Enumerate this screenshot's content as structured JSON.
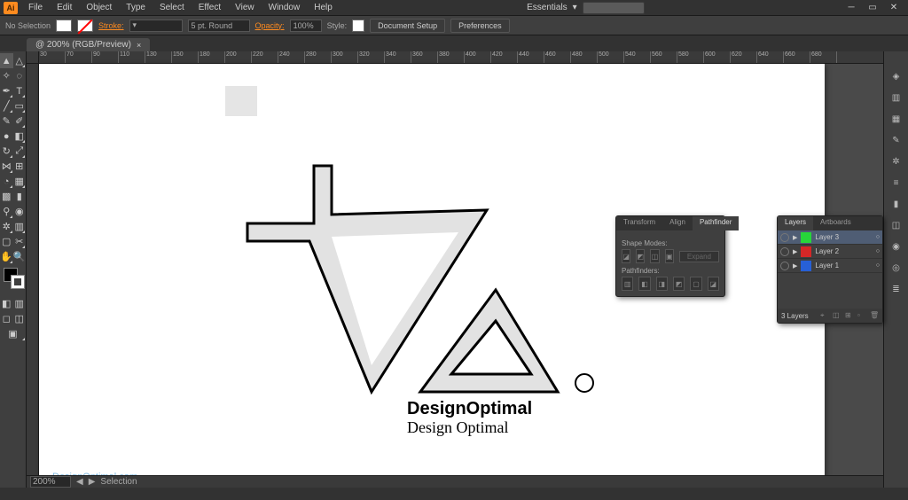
{
  "menu": {
    "items": [
      "File",
      "Edit",
      "Object",
      "Type",
      "Select",
      "Effect",
      "View",
      "Window",
      "Help"
    ],
    "app_badge": "Ai",
    "workspace": "Essentials"
  },
  "optionbar": {
    "no_selection": "No Selection",
    "stroke_label": "Stroke:",
    "stroke_val": "5 pt. Round",
    "opacity_label": "Opacity:",
    "opacity_val": "100%",
    "style_label": "Style:",
    "doc_setup": "Document Setup",
    "prefs": "Preferences"
  },
  "document": {
    "tab_title": "@ 200% (RGB/Preview)"
  },
  "canvas": {
    "logo_text_bold": "DesignOptimal",
    "logo_text_serif": "Design Optimal",
    "watermark": "DesignOptimal.com"
  },
  "ruler_ticks": [
    "30",
    "70",
    "90",
    "110",
    "130",
    "150",
    "180",
    "200",
    "220",
    "240",
    "280",
    "300",
    "320",
    "340",
    "360",
    "380",
    "400",
    "420",
    "440",
    "460",
    "480",
    "500",
    "540",
    "560",
    "580",
    "600",
    "620",
    "640",
    "660",
    "680"
  ],
  "pathfinder": {
    "tabs": [
      "Transform",
      "Align",
      "Pathfinder"
    ],
    "shape_modes": "Shape Modes:",
    "pathfinders": "Pathfinders:",
    "expand": "Expand"
  },
  "layers": {
    "tabs": [
      "Layers",
      "Artboards"
    ],
    "items": [
      {
        "name": "Layer 3",
        "color": "#27d63a"
      },
      {
        "name": "Layer 2",
        "color": "#d62727"
      },
      {
        "name": "Layer 1",
        "color": "#2760d6"
      }
    ],
    "count": "3 Layers"
  },
  "status": {
    "zoom": "200%",
    "tool": "Selection"
  }
}
